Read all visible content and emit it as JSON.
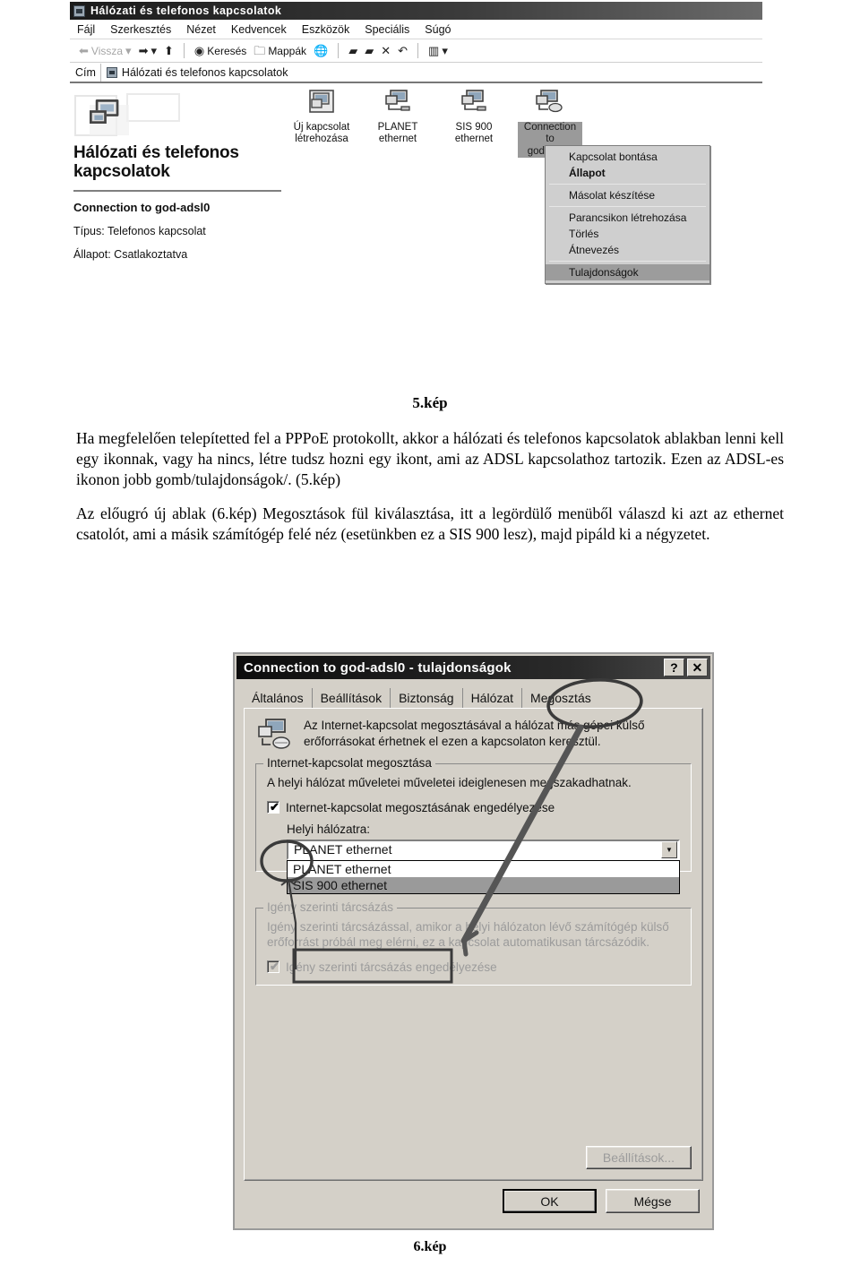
{
  "shot1": {
    "window_title": "Hálózati és telefonos kapcsolatok",
    "menu": [
      "Fájl",
      "Szerkesztés",
      "Nézet",
      "Kedvencek",
      "Eszközök",
      "Speciális",
      "Súgó"
    ],
    "toolbar": {
      "back_label": "Vissza",
      "search_label": "Keresés",
      "folders_label": "Mappák"
    },
    "address": {
      "label": "Cím",
      "value": "Hálózati és telefonos kapcsolatok"
    },
    "left_pane": {
      "title": "Hálózati és telefonos kapcsolatok",
      "selected_name": "Connection to god-adsl0",
      "type_line": "Típus: Telefonos kapcsolat",
      "status_line": "Állapot: Csatlakoztatva"
    },
    "icons": [
      {
        "label_1": "Új kapcsolat",
        "label_2": "létrehozása",
        "selected": false
      },
      {
        "label_1": "PLANET",
        "label_2": "ethernet",
        "selected": false
      },
      {
        "label_1": "SIS 900",
        "label_2": "ethernet",
        "selected": false
      },
      {
        "label_1": "Connection to",
        "label_2": "god-adsl0",
        "selected": true
      }
    ],
    "context_menu": [
      {
        "label": "Kapcsolat bontása",
        "bold": false,
        "highlighted": false,
        "separator_after": false
      },
      {
        "label": "Állapot",
        "bold": true,
        "highlighted": false,
        "separator_after": true
      },
      {
        "label": "Másolat készítése",
        "bold": false,
        "highlighted": false,
        "separator_after": true
      },
      {
        "label": "Parancsikon létrehozása",
        "bold": false,
        "highlighted": false,
        "separator_after": false
      },
      {
        "label": "Törlés",
        "bold": false,
        "highlighted": false,
        "separator_after": false
      },
      {
        "label": "Átnevezés",
        "bold": false,
        "highlighted": false,
        "separator_after": true
      },
      {
        "label": "Tulajdonságok",
        "bold": false,
        "highlighted": true,
        "separator_after": false
      }
    ]
  },
  "doc": {
    "caption_5": "5.kép",
    "caption_6": "6.kép",
    "paragraph_1": "Ha megfelelően telepítetted fel a PPPoE protokollt, akkor a hálózati és telefonos kapcsolatok ablakban lenni kell egy ikonnak, vagy ha nincs, létre tudsz hozni egy ikont, ami az ADSL kapcsolathoz tartozik. Ezen az ADSL-es ikonon jobb gomb/tulajdonságok/. (5.kép)",
    "paragraph_2": "Az előugró új ablak (6.kép) Megosztások fül kiválasztása,  itt a legördülő menüből válaszd ki azt az ethernet csatolót, ami a másik számítógép felé néz (esetünkben ez a SIS 900 lesz), majd pipáld ki a négyzetet."
  },
  "shot2": {
    "title": "Connection to god-adsl0 - tulajdonságok",
    "help_button": "?",
    "close_button": "✕",
    "tabs": [
      {
        "label": "Általános",
        "active": false
      },
      {
        "label": "Beállítások",
        "active": false
      },
      {
        "label": "Biztonság",
        "active": false
      },
      {
        "label": "Hálózat",
        "active": false
      },
      {
        "label": "Megosztás",
        "active": true
      }
    ],
    "info_text": "Az Internet-kapcsolat megosztásával a hálózat más gépei külső erőforrásokat érhetnek el ezen a kapcsolaton keresztül.",
    "group_ics": {
      "title": "Internet-kapcsolat megosztása",
      "text": "A helyi hálózat műveletei műveletei ideiglenesen megszakadhatnak.",
      "checkbox_label": "Internet-kapcsolat megosztásának engedélyezése",
      "checkbox_checked": true,
      "field_label": "Helyi hálózatra:",
      "combo_value": "PLANET ethernet",
      "options": [
        {
          "label": "PLANET ethernet",
          "selected": false
        },
        {
          "label": "SIS 900 ethernet",
          "selected": true
        }
      ]
    },
    "group_demand": {
      "title": "Igény szerinti tárcsázás",
      "text": "Igény szerinti tárcsázással, amikor a helyi hálózaton lévő számítógép külső erőforrást próbál meg elérni, ez a kapcsolat automatikusan tárcsázódik.",
      "checkbox_label": "Igény szerinti tárcsázás engedélyezése",
      "checkbox_checked": true
    },
    "settings_button": "Beállítások...",
    "ok_button": "OK",
    "cancel_button": "Mégse"
  }
}
